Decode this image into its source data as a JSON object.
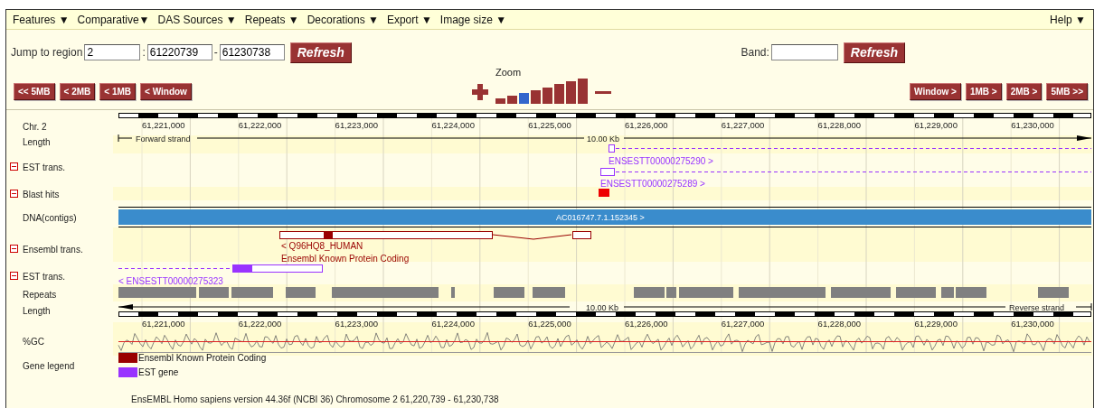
{
  "menu": [
    {
      "label": "Features ▼"
    },
    {
      "label": "Comparative▼"
    },
    {
      "label": "DAS Sources ▼"
    },
    {
      "label": "Repeats ▼"
    },
    {
      "label": "Decorations ▼"
    },
    {
      "label": "Export ▼"
    },
    {
      "label": "Image size ▼"
    }
  ],
  "help": "Help ▼",
  "jump": {
    "label": "Jump to region",
    "chromosome": "2",
    "separator": ":",
    "start": "61220739",
    "dash": "-",
    "end": "61230738",
    "button": "Refresh"
  },
  "band": {
    "label": "Band:",
    "button": "Refresh"
  },
  "nav_back": [
    "<< 5MB",
    "< 2MB",
    "< 1MB",
    "< Window"
  ],
  "zoom": {
    "label": "Zoom",
    "levels": [
      {
        "selected": false
      },
      {
        "selected": false
      },
      {
        "selected": true
      },
      {
        "selected": false
      },
      {
        "selected": false
      },
      {
        "selected": false
      },
      {
        "selected": false
      },
      {
        "selected": false
      }
    ]
  },
  "nav_forward": [
    "Window >",
    "1MB >",
    "2MB >",
    "5MB >>"
  ],
  "tracks": [
    {
      "kind": "ruler",
      "label": "Chr. 2",
      "ticks": [
        "61,221,000",
        "61,222,000",
        "61,223,000",
        "61,224,000",
        "61,225,000",
        "61,226,000",
        "61,227,000",
        "61,228,000",
        "61,229,000",
        "61,230,000"
      ]
    },
    {
      "kind": "length",
      "label": "Length",
      "strand": "Forward strand",
      "span": "10.00 Kb"
    },
    {
      "kind": "est",
      "label": "EST trans.",
      "collapsible": true,
      "features": [
        "ENSESTT00000275290 >",
        "ENSESTT00000275289 >"
      ]
    },
    {
      "kind": "blast",
      "label": "Blast hits",
      "collapsible": true
    },
    {
      "kind": "contig",
      "label": "DNA(contigs)",
      "feature": "AC016747.7.1.152345 >"
    },
    {
      "kind": "ensembl",
      "label": "Ensembl trans.",
      "collapsible": true,
      "features": [
        "< Q96HQ8_HUMAN",
        "Ensembl Known Protein Coding"
      ]
    },
    {
      "kind": "est_reverse",
      "label": "EST trans.",
      "collapsible": true,
      "features": [
        "< ENSESTT00000275323"
      ]
    },
    {
      "kind": "repeats",
      "label": "Repeats"
    },
    {
      "kind": "length",
      "label": "Length",
      "strand": "Reverse strand",
      "span": "10.00 Kb"
    },
    {
      "kind": "ruler",
      "ticks": [
        "61,221,000",
        "61,222,000",
        "61,223,000",
        "61,224,000",
        "61,225,000",
        "61,226,000",
        "61,227,000",
        "61,228,000",
        "61,229,000",
        "61,230,000"
      ]
    },
    {
      "kind": "gc",
      "label": "%GC"
    },
    {
      "kind": "legend",
      "label": "Gene legend",
      "items": [
        {
          "label": "Ensembl Known Protein Coding",
          "color": "#990000"
        },
        {
          "label": "EST gene",
          "color": "#9933ff"
        }
      ]
    }
  ],
  "footer": "EnsEMBL Homo sapiens version 44.36f (NCBI 36) Chromosome 2 61,220,739 - 61,230,738"
}
